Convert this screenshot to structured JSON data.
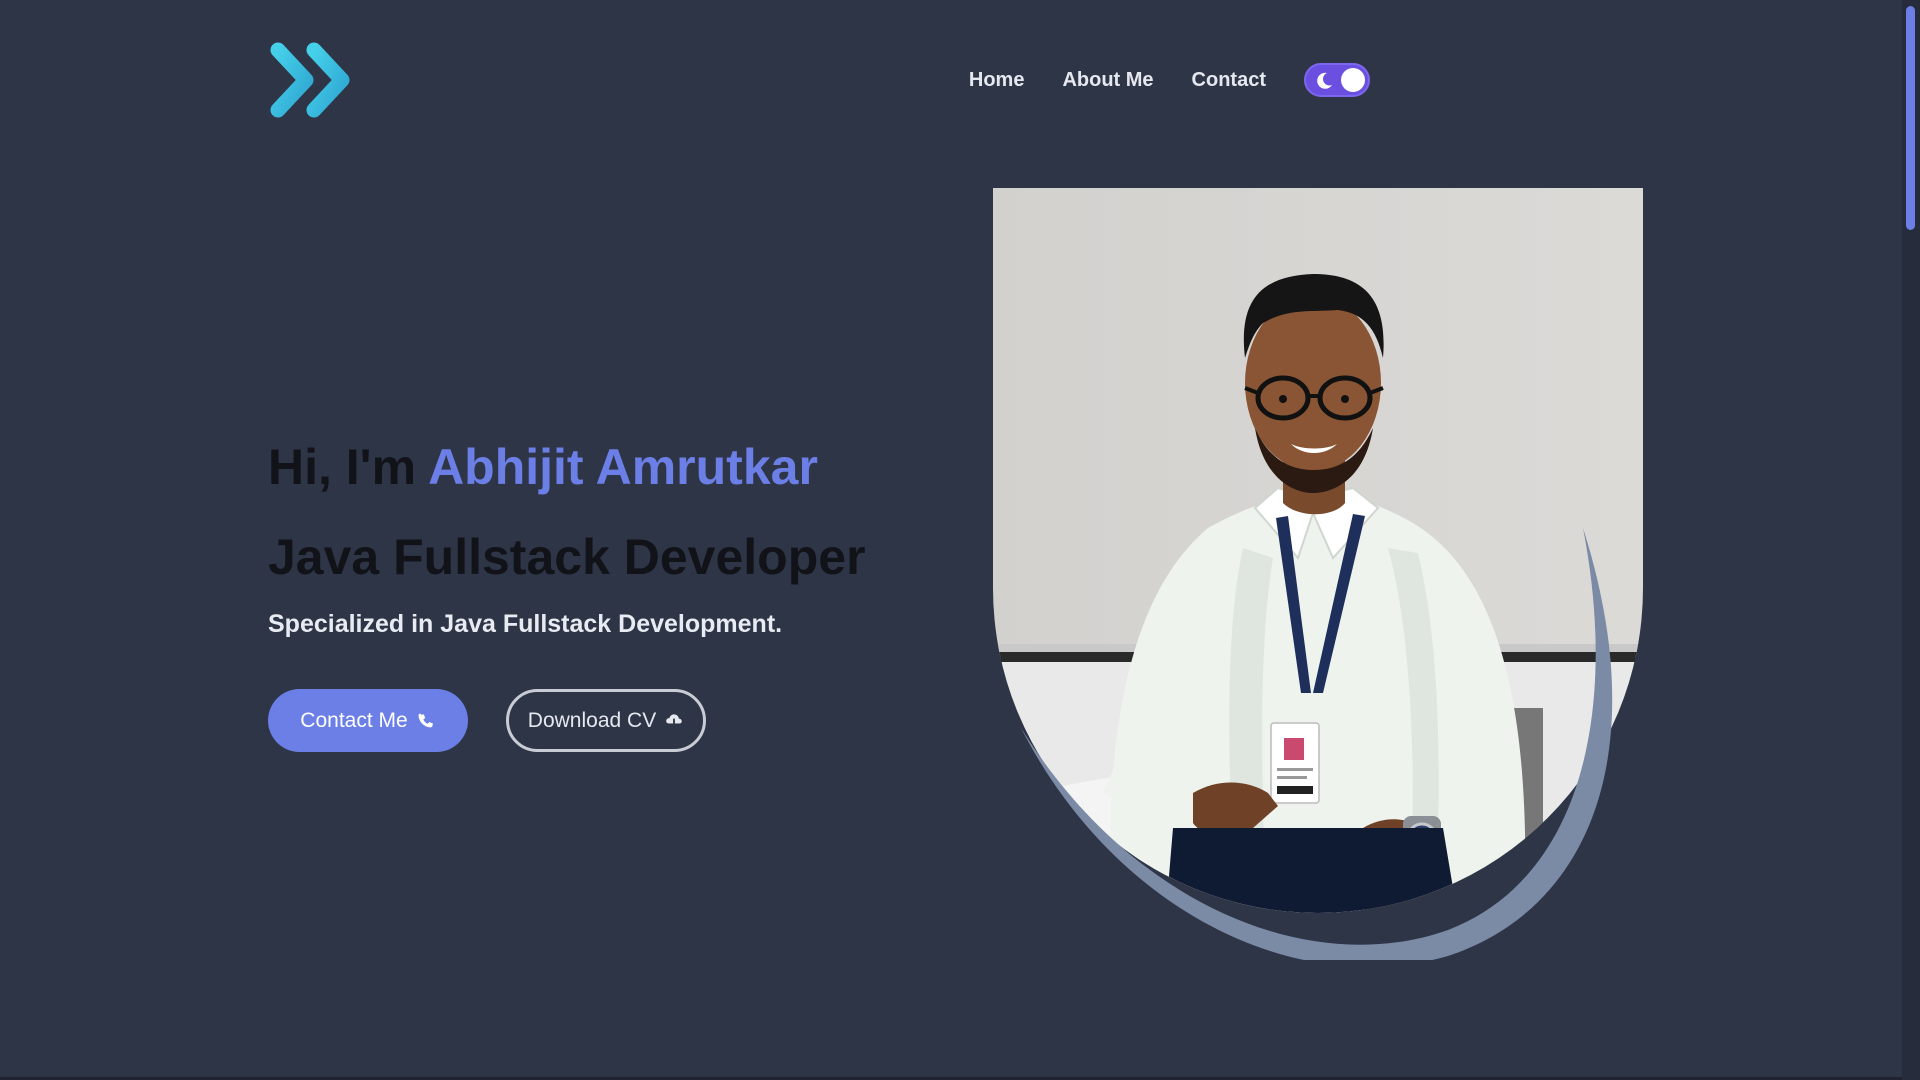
{
  "header": {
    "logo_icon": "double-chevron-right-icon",
    "nav": [
      {
        "label": "Home"
      },
      {
        "label": "About Me"
      },
      {
        "label": "Contact"
      }
    ],
    "theme_toggle": {
      "icon": "moon-icon",
      "state": "dark"
    }
  },
  "hero": {
    "greeting_prefix": "Hi, I'm ",
    "name": "Abhijit Amrutkar",
    "role": "Java Fullstack Developer",
    "subtitle": "Specialized in Java Fullstack Development.",
    "contact_button": {
      "label": "Contact Me",
      "icon": "phone-icon"
    },
    "cv_button": {
      "label": "Download CV",
      "icon": "cloud-download-icon"
    }
  },
  "colors": {
    "background": "#2e3547",
    "accent": "#6b7fe6",
    "logo": "#3fc1e0",
    "toggle": "#6a4fe0",
    "arc": "#7b8aa5"
  }
}
